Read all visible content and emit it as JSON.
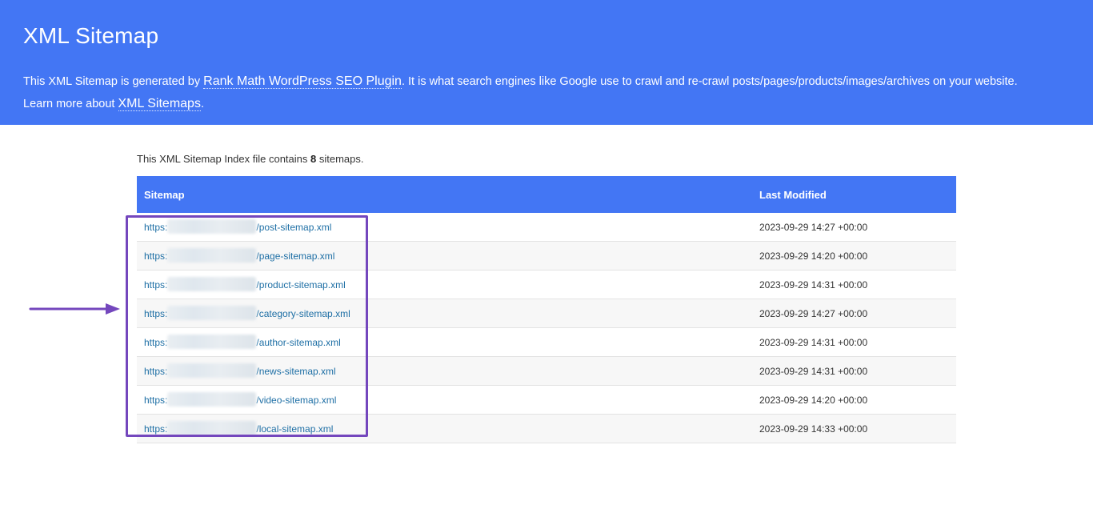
{
  "header": {
    "title": "XML Sitemap",
    "desc_part1": "This XML Sitemap is generated by ",
    "link_plugin": "Rank Math WordPress SEO Plugin",
    "desc_part2": ". It is what search engines like Google use to crawl and re-crawl posts/pages/products/images/archives on your website.",
    "desc_part3": "Learn more about ",
    "link_sitemaps": "XML Sitemaps",
    "desc_part4": "."
  },
  "intro": {
    "prefix": "This XML Sitemap Index file contains ",
    "count": "8",
    "suffix": " sitemaps."
  },
  "table": {
    "col_sitemap": "Sitemap",
    "col_modified": "Last Modified",
    "url_prefix": "https:",
    "rows": [
      {
        "path": "/post-sitemap.xml",
        "modified": "2023-09-29 14:27 +00:00"
      },
      {
        "path": "/page-sitemap.xml",
        "modified": "2023-09-29 14:20 +00:00"
      },
      {
        "path": "/product-sitemap.xml",
        "modified": "2023-09-29 14:31 +00:00"
      },
      {
        "path": "/category-sitemap.xml",
        "modified": "2023-09-29 14:27 +00:00"
      },
      {
        "path": "/author-sitemap.xml",
        "modified": "2023-09-29 14:31 +00:00"
      },
      {
        "path": "/news-sitemap.xml",
        "modified": "2023-09-29 14:31 +00:00"
      },
      {
        "path": "/video-sitemap.xml",
        "modified": "2023-09-29 14:20 +00:00"
      },
      {
        "path": "/local-sitemap.xml",
        "modified": "2023-09-29 14:33 +00:00"
      }
    ]
  },
  "colors": {
    "header_bg": "#4376f4",
    "link": "#1e6fa5",
    "annotation": "#7447bd"
  }
}
